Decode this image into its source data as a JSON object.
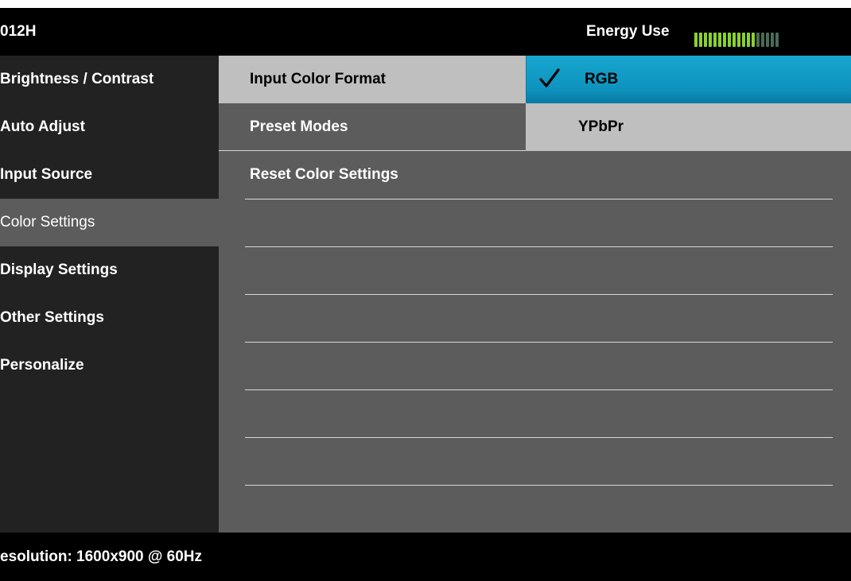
{
  "header": {
    "model": "012H",
    "energy_label": "Energy Use",
    "energy_level": {
      "filled": 13,
      "total": 18
    },
    "energy_colors": {
      "filled": "#8ad12e",
      "empty": "#4a6b55"
    }
  },
  "left_menu": {
    "items": [
      {
        "label": "Brightness / Contrast"
      },
      {
        "label": "Auto Adjust"
      },
      {
        "label": "Input Source"
      },
      {
        "label": "Color Settings"
      },
      {
        "label": "Display Settings"
      },
      {
        "label": "Other Settings"
      },
      {
        "label": "Personalize"
      }
    ],
    "selected": "Color Settings"
  },
  "submenu": {
    "items": [
      {
        "label": "Input Color Format"
      },
      {
        "label": "Preset Modes"
      },
      {
        "label": "Reset Color Settings"
      }
    ],
    "active": "Input Color Format"
  },
  "options": {
    "items": [
      {
        "label": "RGB",
        "checked": true
      },
      {
        "label": "YPbPr",
        "checked": false
      }
    ],
    "check_icon": "check-icon"
  },
  "footer": {
    "resolution": "esolution: 1600x900 @ 60Hz"
  },
  "colors": {
    "header_bg": "#000000",
    "left_bg": "#222222",
    "main_bg": "#5c5c5c",
    "active_bg": "#bfbfbf",
    "highlight": "#0e93be"
  }
}
